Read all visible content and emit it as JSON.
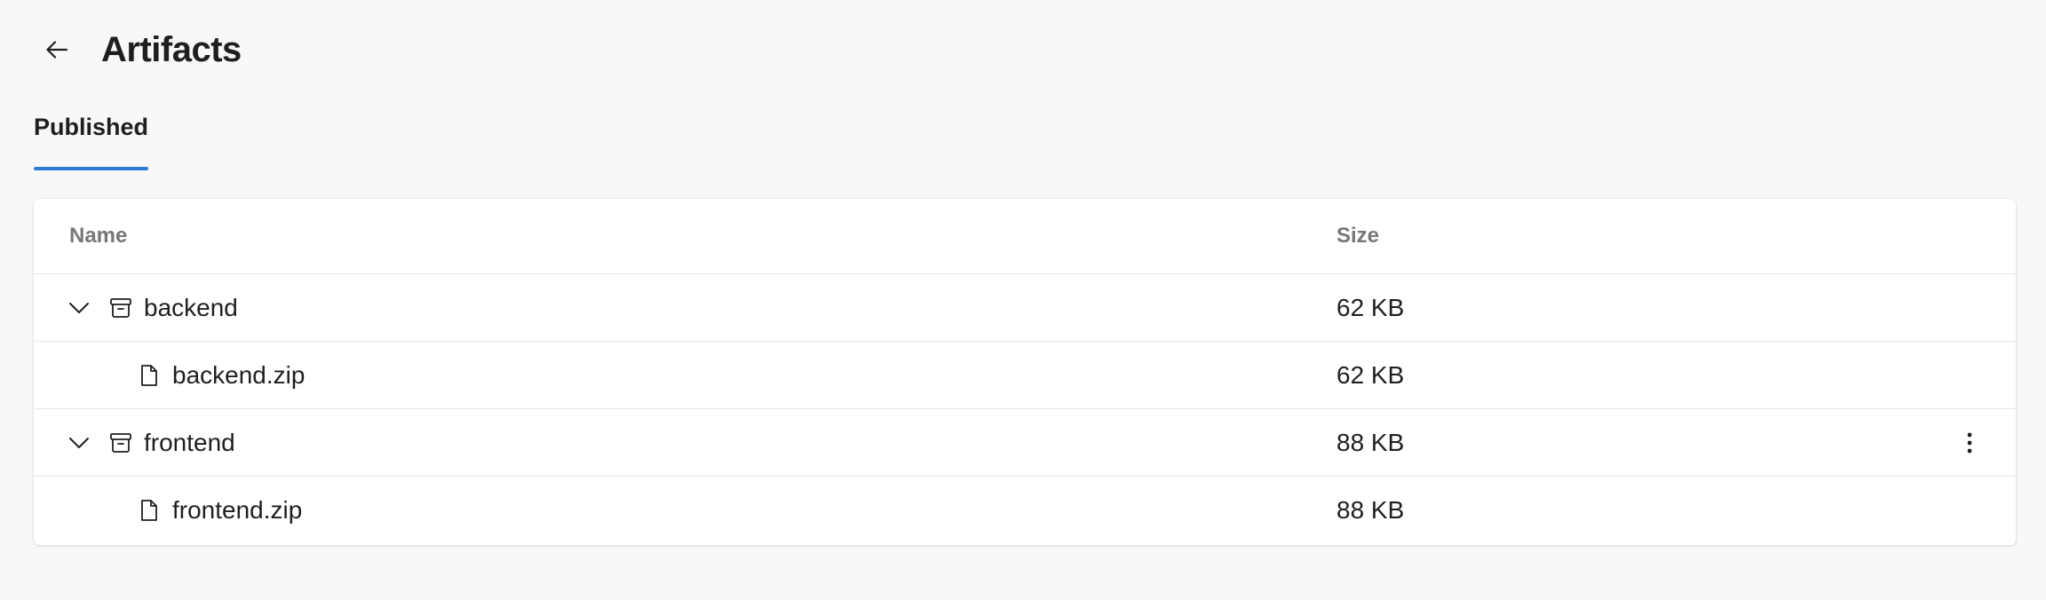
{
  "page": {
    "title": "Artifacts",
    "back_icon": "arrow-left-icon"
  },
  "tabs": [
    {
      "label": "Published",
      "selected": true
    }
  ],
  "table": {
    "columns": {
      "name": "Name",
      "size": "Size"
    },
    "rows": [
      {
        "type": "folder",
        "name": "backend",
        "size": "62 KB",
        "expanded": true,
        "icon": "archive-box-icon"
      },
      {
        "type": "file",
        "name": "backend.zip",
        "size": "62 KB",
        "icon": "file-icon"
      },
      {
        "type": "folder",
        "name": "frontend",
        "size": "88 KB",
        "expanded": true,
        "icon": "archive-box-icon",
        "has_more_menu": true
      },
      {
        "type": "file",
        "name": "frontend.zip",
        "size": "88 KB",
        "icon": "file-icon"
      }
    ]
  },
  "colors": {
    "accent": "#2e7ad6",
    "background": "#f8f8f8",
    "header_text": "#797775"
  }
}
